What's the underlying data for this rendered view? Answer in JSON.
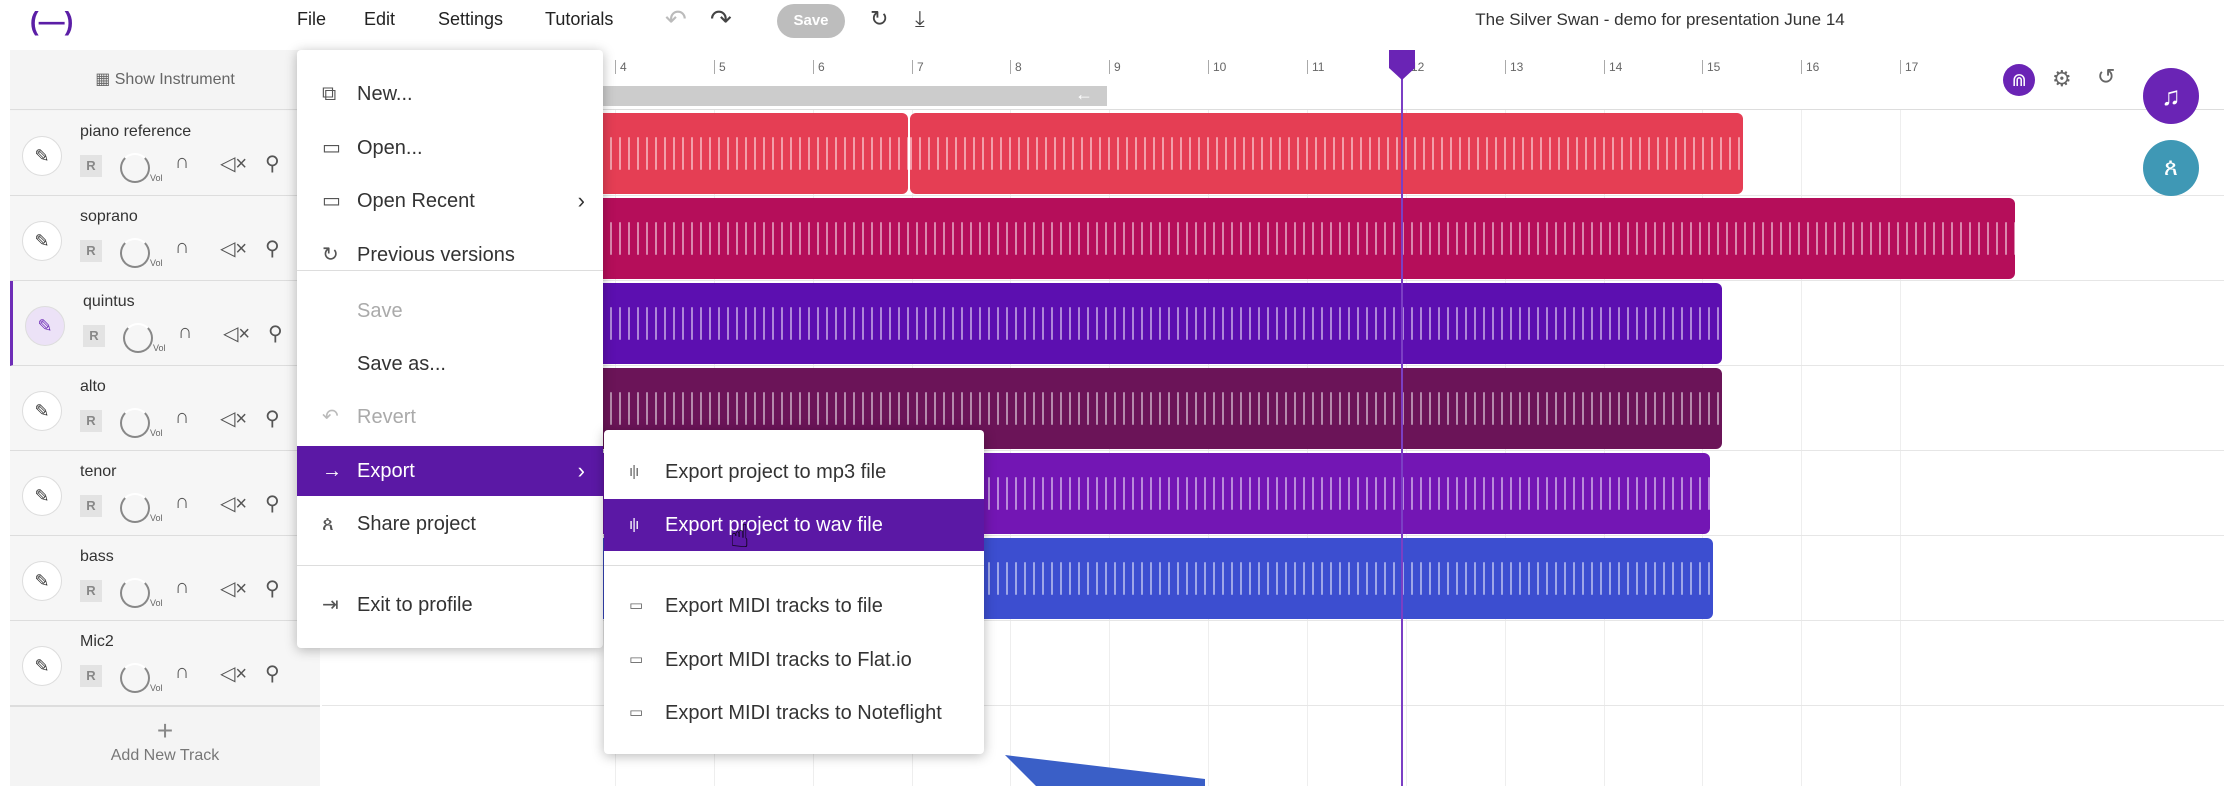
{
  "app": {
    "logo": "(—)",
    "title": "The Silver Swan - demo for presentation June 14"
  },
  "menubar": {
    "file": "File",
    "edit": "Edit",
    "settings": "Settings",
    "tutorials": "Tutorials",
    "save": "Save"
  },
  "toolbar": {
    "show_instrument": "Show Instrument",
    "add_track": "Add New Track"
  },
  "ruler": [
    "4",
    "5",
    "6",
    "7",
    "8",
    "9",
    "10",
    "11",
    "12",
    "13",
    "14",
    "15",
    "16",
    "17"
  ],
  "tracks": [
    {
      "name": "piano reference",
      "color": "#e53e54"
    },
    {
      "name": "soprano",
      "color": "#b50e5a"
    },
    {
      "name": "quintus",
      "color": "#5c0fb0"
    },
    {
      "name": "alto",
      "color": "#6b1458"
    },
    {
      "name": "tenor",
      "color": "#7316b4"
    },
    {
      "name": "bass",
      "color": "#3c4ed0"
    },
    {
      "name": "Mic2",
      "color": ""
    }
  ],
  "track_controls": {
    "record": "R",
    "volume": "Vol"
  },
  "file_menu": {
    "new": "New...",
    "open": "Open...",
    "open_recent": "Open Recent",
    "previous_versions": "Previous versions",
    "save": "Save",
    "save_as": "Save as...",
    "revert": "Revert",
    "export": "Export",
    "share": "Share project",
    "exit": "Exit to profile"
  },
  "export_menu": {
    "mp3": "Export project to mp3 file",
    "wav": "Export project to wav file",
    "midi_file": "Export MIDI tracks to file",
    "midi_flat": "Export MIDI tracks to Flat.io",
    "midi_noteflight": "Export MIDI tracks to Noteflight"
  },
  "icons": {
    "undo": "undo-icon",
    "redo": "redo-icon",
    "refresh": "refresh-icon",
    "download": "download-icon"
  }
}
